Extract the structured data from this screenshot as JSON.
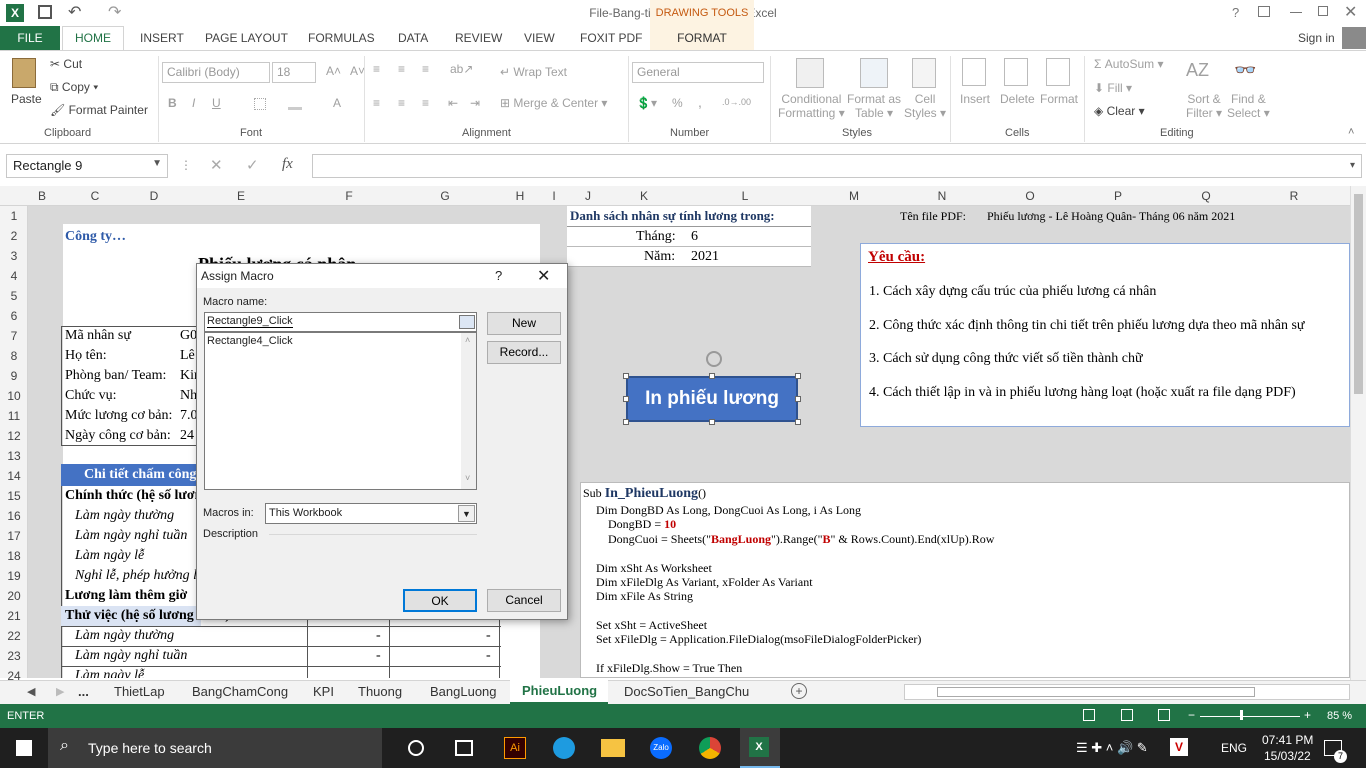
{
  "window": {
    "title": "File-Bang-tinh-luong_DeBai - Excel",
    "help": "?",
    "signin": "Sign in"
  },
  "drawing_tools": "DRAWING TOOLS",
  "tabs": [
    "FILE",
    "HOME",
    "INSERT",
    "PAGE LAYOUT",
    "FORMULAS",
    "DATA",
    "REVIEW",
    "VIEW",
    "FOXIT PDF",
    "FORMAT"
  ],
  "ribbon": {
    "clipboard": {
      "paste": "Paste",
      "cut": "Cut",
      "copy": "Copy",
      "format_painter": "Format Painter",
      "group": "Clipboard"
    },
    "font": {
      "name": "Calibri (Body)",
      "size": "18",
      "bold": "B",
      "italic": "I",
      "underline": "U",
      "group": "Font"
    },
    "alignment": {
      "wrap": "Wrap Text",
      "merge": "Merge & Center",
      "group": "Alignment"
    },
    "number": {
      "format": "General",
      "percent": "%",
      "comma": ",",
      "group": "Number"
    },
    "styles": {
      "cond1": "Conditional",
      "cond2": "Formatting",
      "fat1": "Format as",
      "fat2": "Table",
      "cs1": "Cell",
      "cs2": "Styles",
      "group": "Styles"
    },
    "cells": {
      "insert": "Insert",
      "delete": "Delete",
      "format": "Format",
      "group": "Cells"
    },
    "editing": {
      "autosum": "AutoSum",
      "fill": "Fill",
      "clear": "Clear",
      "sort1": "Sort &",
      "sort2": "Filter",
      "find1": "Find &",
      "find2": "Select",
      "group": "Editing"
    }
  },
  "namebox": "Rectangle 9",
  "fx": "fx",
  "columns": [
    "B",
    "C",
    "D",
    "E",
    "F",
    "G",
    "H",
    "I",
    "J",
    "K",
    "L",
    "M",
    "N",
    "O",
    "P",
    "Q",
    "R"
  ],
  "rows": [
    "1",
    "2",
    "3",
    "4",
    "5",
    "6",
    "7",
    "8",
    "9",
    "10",
    "11",
    "12",
    "13",
    "14",
    "15",
    "16",
    "17",
    "18",
    "19",
    "20",
    "21",
    "22",
    "23",
    "24"
  ],
  "sheet": {
    "company": "Công ty…",
    "payslip_title": "Phiếu lương cá nhân",
    "labels": [
      "Mã nhân sự",
      "Họ tên:",
      "Phòng ban/ Team:",
      "Chức vụ:",
      "Mức lương cơ bản:",
      "Ngày công cơ bản:"
    ],
    "values": [
      "G0",
      "Lê",
      "Kin",
      "Nh",
      "7.0",
      "24"
    ],
    "detail_header": "Chi tiết chấm công",
    "sections": [
      "Chính thức (hệ số lương",
      "Làm ngày thường",
      "Làm ngày nghỉ tuần",
      "Làm ngày lễ",
      "Nghỉ lễ, phép hưởng l",
      "Lương làm thêm giờ",
      "Thử việc (hệ số lương 85%)",
      "Làm ngày thường",
      "Làm ngày nghỉ tuần",
      "Làm ngày lễ"
    ],
    "dash": "-",
    "list_title": "Danh sách nhân sự tính lương trong:",
    "month_label": "Tháng:",
    "month": "6",
    "year_label": "Năm:",
    "year": "2021",
    "pdf_label": "Tên file PDF:",
    "pdf_name": "Phiếu lương - Lê Hoàng Quân- Tháng 06 năm 2021",
    "req_title": "Yêu cầu:",
    "reqs": [
      "1. Cách xây dựng cấu trúc của phiếu lương cá nhân",
      "2. Công thức xác định thông tin chi tiết trên phiếu lương dựa theo mã nhân sự",
      "3. Cách sử dụng công thức viết số tiền thành chữ",
      "4. Cách thiết lập in và in phiếu lương hàng loạt (hoặc xuất ra file dạng PDF)"
    ],
    "button": "In phiếu lương",
    "code": [
      "Dim DongBD As Long, DongCuoi As Long, i As Long",
      "Dim xSht As Worksheet",
      "Dim xFileDlg As Variant, xFolder As Variant",
      "Dim xFile  As String",
      "Set xSht = ActiveSheet",
      "Set xFileDlg = Application.FileDialog(msoFileDialogFolderPicker)",
      "If xFileDlg.Show = True Then"
    ],
    "code_sub": "Sub ",
    "code_name": "In_PhieuLuong",
    "code_paren": "()",
    "code_dbd": "DongBD = ",
    "code_10": "10",
    "code_dc1": "DongCuoi = Sheets(\"",
    "code_bl": "BangLuong",
    "code_dc2": "\").Range(\"",
    "code_b": "B",
    "code_dc3": "\" & Rows.Count).End(xlUp).Row"
  },
  "dialog": {
    "title": "Assign Macro",
    "help": "?",
    "macro_name_label": "Macro name:",
    "macro_name": "Rectangle9_Click",
    "macros": [
      "Rectangle4_Click"
    ],
    "new": "New",
    "record": "Record...",
    "macros_in_label": "Macros in:",
    "macros_in": "This Workbook",
    "description": "Description",
    "ok": "OK",
    "cancel": "Cancel"
  },
  "sheet_tabs": [
    "...",
    "ThietLap",
    "BangChamCong",
    "KPI",
    "Thuong",
    "BangLuong",
    "PhieuLuong",
    "DocSoTien_BangChu"
  ],
  "status": {
    "mode": "ENTER",
    "zoom": "85 %"
  },
  "taskbar": {
    "search": "Type here to search",
    "time": "07:41 PM",
    "date": "15/03/22",
    "lang": "ENG",
    "notif": "7"
  }
}
